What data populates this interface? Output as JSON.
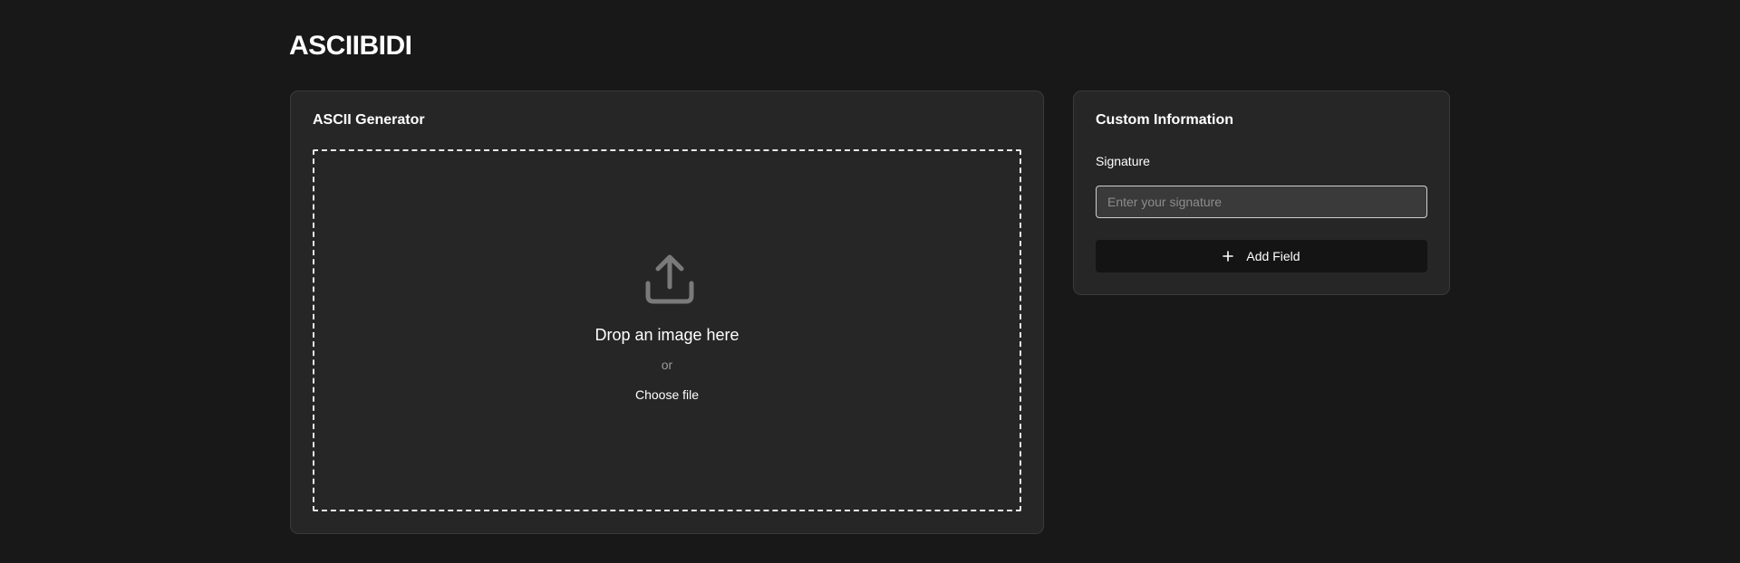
{
  "app": {
    "title": "ASCIIBIDI"
  },
  "generator": {
    "title": "ASCII Generator",
    "dropzone": {
      "icon": "upload-icon",
      "prompt": "Drop an image here",
      "or_text": "or",
      "choose_file_label": "Choose file"
    }
  },
  "custom_info": {
    "title": "Custom Information",
    "signature": {
      "label": "Signature",
      "value": "",
      "placeholder": "Enter your signature"
    },
    "add_field": {
      "icon": "plus-icon",
      "label": "Add Field"
    }
  },
  "colors": {
    "background": "#181818",
    "card": "#262626",
    "card_border": "#3a3a3a",
    "button": "#141414",
    "icon": "#7a7a7a"
  }
}
